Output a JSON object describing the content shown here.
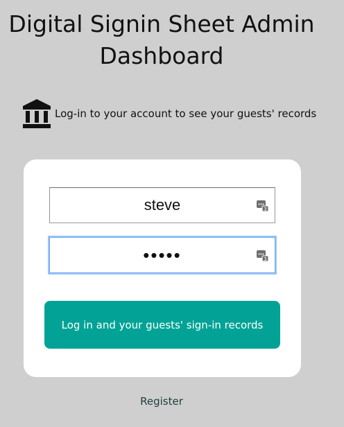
{
  "header": {
    "title_line1": "Digital Signin Sheet Admin",
    "title_line2": "Dashboard"
  },
  "intro": {
    "icon": "institution-icon",
    "text": "Log-in to your account to see your guests' records"
  },
  "form": {
    "username_value": "steve",
    "password_value": "•••••",
    "autofill_icon": "password-manager-icon",
    "submit_label": "Log in and your guests' sign-in records"
  },
  "footer": {
    "register_label": "Register"
  },
  "colors": {
    "background": "#cfcfcf",
    "card": "#ffffff",
    "button": "#02a396",
    "focus_ring": "#9cc4f7"
  }
}
